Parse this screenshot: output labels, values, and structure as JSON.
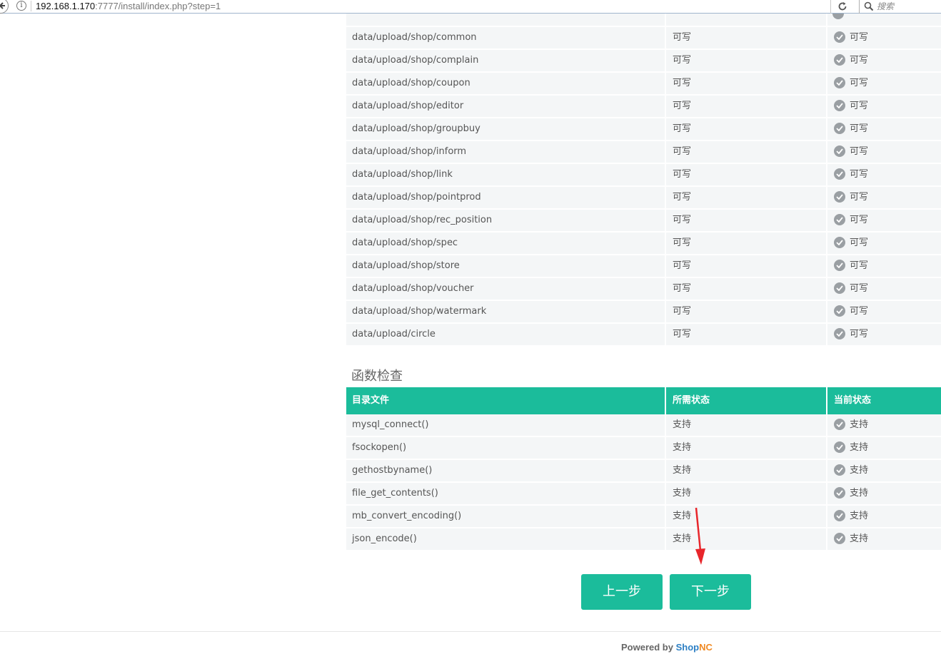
{
  "browser": {
    "url_host": "192.168.1.170",
    "url_rest": ":7777/install/index.php?step=1",
    "search_placeholder": "搜索"
  },
  "dir_table": {
    "rows": [
      {
        "path": "data/upload/shop/common",
        "required": "可写",
        "current": "可写"
      },
      {
        "path": "data/upload/shop/complain",
        "required": "可写",
        "current": "可写"
      },
      {
        "path": "data/upload/shop/coupon",
        "required": "可写",
        "current": "可写"
      },
      {
        "path": "data/upload/shop/editor",
        "required": "可写",
        "current": "可写"
      },
      {
        "path": "data/upload/shop/groupbuy",
        "required": "可写",
        "current": "可写"
      },
      {
        "path": "data/upload/shop/inform",
        "required": "可写",
        "current": "可写"
      },
      {
        "path": "data/upload/shop/link",
        "required": "可写",
        "current": "可写"
      },
      {
        "path": "data/upload/shop/pointprod",
        "required": "可写",
        "current": "可写"
      },
      {
        "path": "data/upload/shop/rec_position",
        "required": "可写",
        "current": "可写"
      },
      {
        "path": "data/upload/shop/spec",
        "required": "可写",
        "current": "可写"
      },
      {
        "path": "data/upload/shop/store",
        "required": "可写",
        "current": "可写"
      },
      {
        "path": "data/upload/shop/voucher",
        "required": "可写",
        "current": "可写"
      },
      {
        "path": "data/upload/shop/watermark",
        "required": "可写",
        "current": "可写"
      },
      {
        "path": "data/upload/circle",
        "required": "可写",
        "current": "可写"
      }
    ]
  },
  "func_section": {
    "title": "函数检查",
    "headers": [
      "目录文件",
      "所需状态",
      "当前状态"
    ],
    "rows": [
      {
        "name": "mysql_connect()",
        "required": "支持",
        "current": "支持"
      },
      {
        "name": "fsockopen()",
        "required": "支持",
        "current": "支持"
      },
      {
        "name": "gethostbyname()",
        "required": "支持",
        "current": "支持"
      },
      {
        "name": "file_get_contents()",
        "required": "支持",
        "current": "支持"
      },
      {
        "name": "mb_convert_encoding()",
        "required": "支持",
        "current": "支持"
      },
      {
        "name": "json_encode()",
        "required": "支持",
        "current": "支持"
      }
    ]
  },
  "buttons": {
    "prev": "上一步",
    "next": "下一步"
  },
  "footer": {
    "powered": "Powered by ",
    "brand_shop": "Shop",
    "brand_nc": "NC"
  },
  "colors": {
    "accent": "#1bbc9b",
    "check_icon": "#9a9fa3",
    "annotation_arrow": "#e8262b"
  }
}
